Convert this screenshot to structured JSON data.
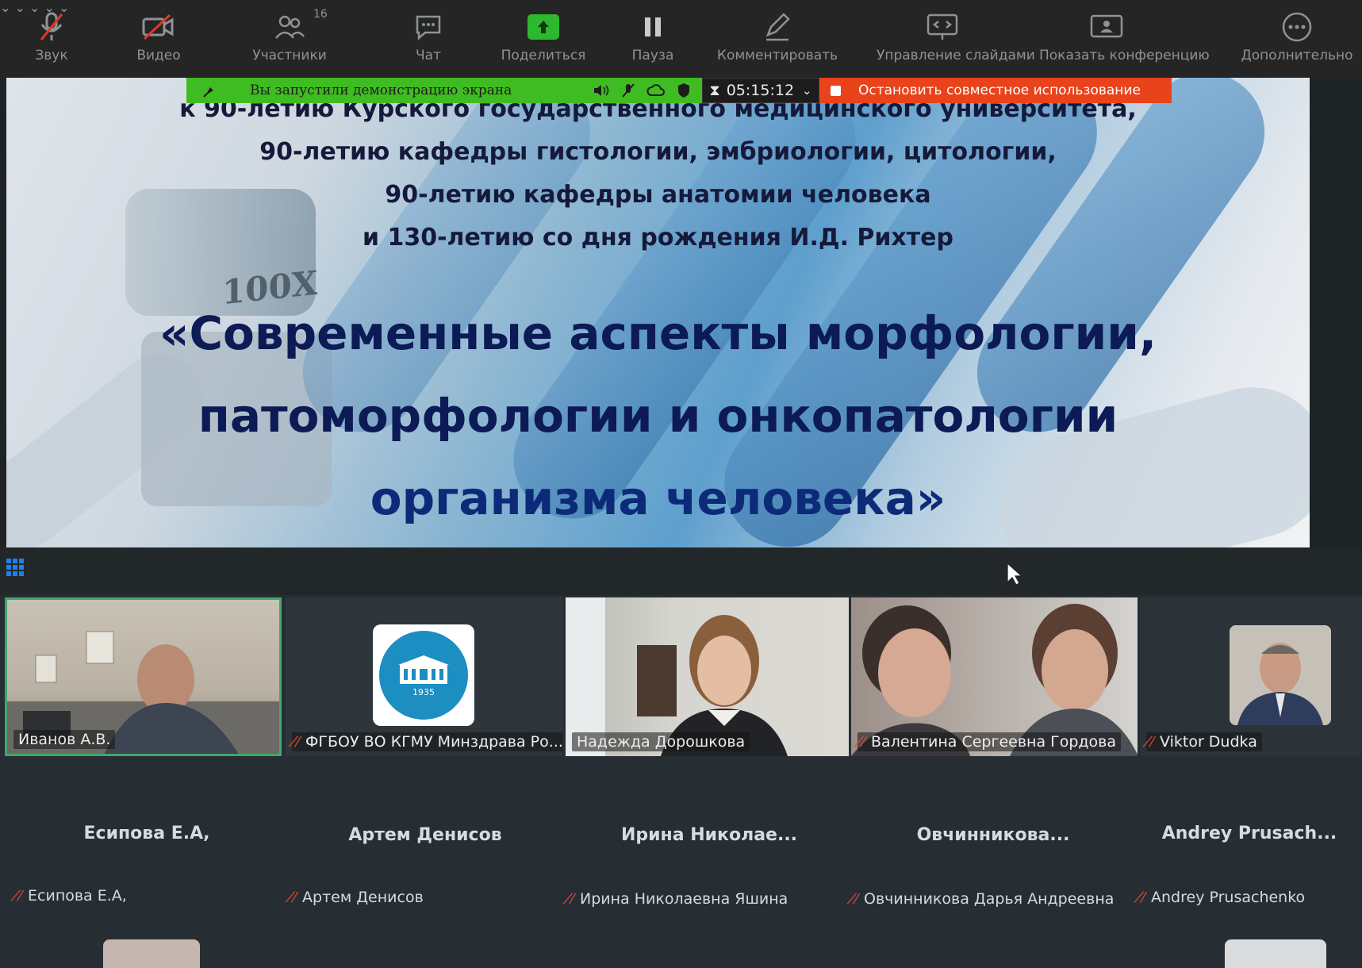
{
  "toolbar": {
    "audio_label": "Звук",
    "video_label": "Видео",
    "participants_label": "Участники",
    "participants_count": "16",
    "chat_label": "Чат",
    "share_label": "Поделиться",
    "pause_label": "Пауза",
    "annotate_label": "Комментировать",
    "slides_label": "Управление слайдами",
    "show_conf_label": "Показать конференцию",
    "more_label": "Дополнительно"
  },
  "share_bar": {
    "status_text": "Вы запустили демонстрацию экрана",
    "timer": "05:15:12",
    "stop_label": "Остановить совместное использование",
    "colors": {
      "green": "#3fbc21",
      "stop": "#e8431b"
    }
  },
  "slide": {
    "line1": "к 90-летию Курского государственного медицинского университета,",
    "line2": "90-летию кафедры гистологии, эмбриологии, цитологии,",
    "line3": "90-летию кафедры анатомии человека",
    "line4": "и 130-летию со дня рождения И.Д. Рихтер",
    "title1": "«Современные аспекты морфологии,",
    "title2": "патоморфологии и онкопатологии",
    "title3": "организма человека»",
    "lens_mark": "100X"
  },
  "participants": {
    "top_row": [
      {
        "name": "Иванов А.В.",
        "muted": false,
        "active_speaker": true
      },
      {
        "name": "ФГБОУ ВО КГМУ Минздрава Ро...",
        "muted": true
      },
      {
        "name": "Надежда Дорошкова",
        "muted": false
      },
      {
        "name": "Валентина Сергеевна Гордова",
        "muted": true
      },
      {
        "name": "Viktor Dudka",
        "muted": true
      }
    ],
    "bottom_row": [
      {
        "display": "Есипова Е.А,",
        "name": "Есипова Е.А,"
      },
      {
        "display": "Артем Денисов",
        "name": "Артем Денисов"
      },
      {
        "display": "Ирина Николае...",
        "name": "Ирина Николаевна Яшина"
      },
      {
        "display": "Овчинникова...",
        "name": "Овчинникова Дарья Андреевна"
      },
      {
        "display": "Andrey Prusach...",
        "name": "Andrey Prusachenko"
      }
    ],
    "logo_year": "1935"
  }
}
